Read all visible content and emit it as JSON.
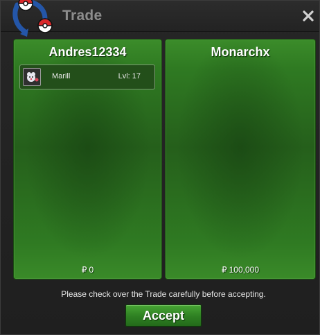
{
  "window": {
    "title": "Trade",
    "close_icon": "close-icon",
    "logo_icon": "pokeball-swap-icon"
  },
  "left_panel": {
    "player": "Andres12334",
    "items": [
      {
        "name": "Marill",
        "level": "Lvl: 17",
        "icon": "marill-icon"
      }
    ],
    "money_symbol": "₽",
    "money": "0"
  },
  "right_panel": {
    "player": "Monarchx",
    "items": [],
    "money_symbol": "₽",
    "money": "100,000"
  },
  "footer": {
    "note": "Please check over the Trade carefully before accepting.",
    "accept_label": "Accept"
  },
  "colors": {
    "panel_green": "#2f7a22",
    "button_green": "#47a534",
    "titlebar": "#2c2c2c",
    "pokeball_red": "#d8282a",
    "pokeball_blue": "#2456a8"
  }
}
